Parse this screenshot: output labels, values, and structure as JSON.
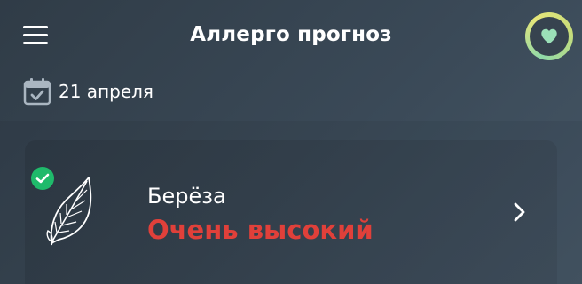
{
  "header": {
    "title": "Аллерго прогноз",
    "menu_icon": "menu-icon",
    "favorite_icon": "heart-icon"
  },
  "date": {
    "icon": "calendar-icon",
    "label": "21 апреля"
  },
  "forecast_items": [
    {
      "plant": "Берёза",
      "level": "Очень высокий",
      "level_color": "#e0403a",
      "selected": true
    }
  ],
  "colors": {
    "background": "#3a4957",
    "accent_green": "#1fba6b",
    "danger": "#e0403a"
  }
}
